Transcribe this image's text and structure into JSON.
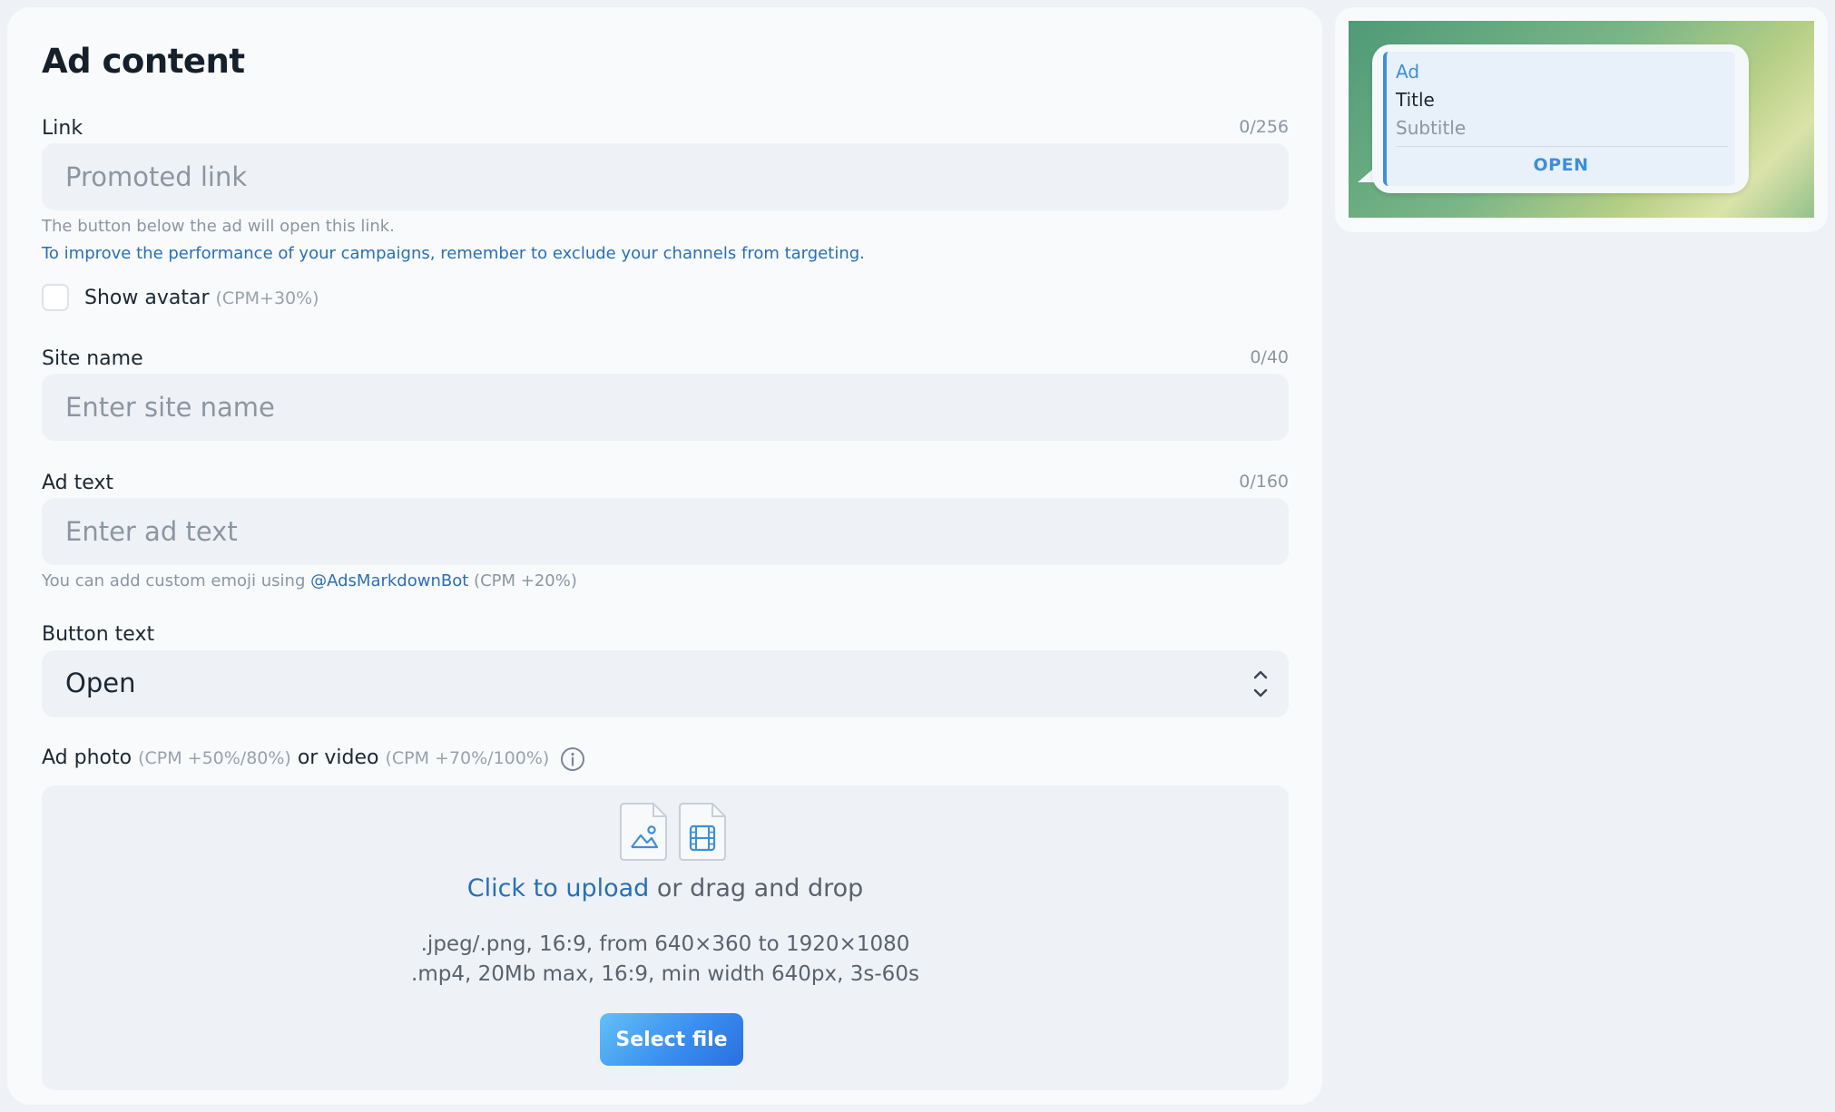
{
  "form": {
    "title": "Ad content",
    "link": {
      "label": "Link",
      "counter": "0/256",
      "placeholder": "Promoted link",
      "hint": "The button below the ad will open this link.",
      "hint_blue": "To improve the performance of your campaigns, remember to exclude your channels from targeting."
    },
    "avatar": {
      "label": "Show avatar",
      "note": "(CPM+30%)",
      "checked": false
    },
    "site_name": {
      "label": "Site name",
      "counter": "0/40",
      "placeholder": "Enter site name"
    },
    "ad_text": {
      "label": "Ad text",
      "counter": "0/160",
      "placeholder": "Enter ad text",
      "hint_prefix": "You can add custom emoji using",
      "hint_link": "@AdsMarkdownBot",
      "hint_suffix": "(CPM +20%)"
    },
    "button_text": {
      "label": "Button text",
      "value": "Open"
    },
    "media": {
      "label_photo": "Ad photo",
      "photo_note": "(CPM +50%/80%)",
      "label_or_video": "or video",
      "video_note": "(CPM +70%/100%)",
      "upload_link": "Click to upload",
      "upload_rest": "or drag and drop",
      "spec_image": ".jpeg/.png, 16:9, from 640×360 to 1920×1080",
      "spec_video": ".mp4, 20Mb max, 16:9, min width 640px, 3s-60s",
      "select_button": "Select file"
    }
  },
  "preview": {
    "tag": "Ad",
    "title": "Title",
    "subtitle": "Subtitle",
    "button": "OPEN"
  },
  "colors": {
    "accent": "#2a6fb4",
    "preview_accent": "#3e8fd8",
    "field_bg": "#eef2f6"
  }
}
